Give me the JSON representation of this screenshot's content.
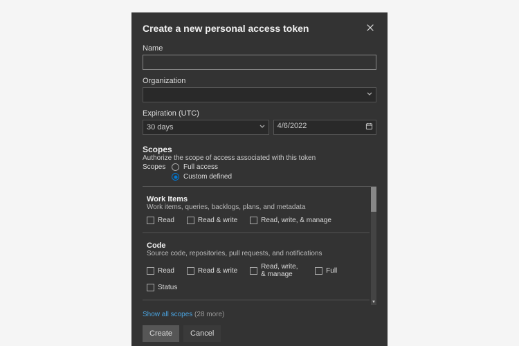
{
  "dialog": {
    "title": "Create a new personal access token"
  },
  "fields": {
    "name_label": "Name",
    "name_value": "",
    "org_label": "Organization",
    "org_value": "",
    "expiration_label": "Expiration (UTC)",
    "expiration_period": "30 days",
    "expiration_date": "4/6/2022"
  },
  "scopes": {
    "heading": "Scopes",
    "description": "Authorize the scope of access associated with this token",
    "label": "Scopes",
    "options": {
      "full": "Full access",
      "custom": "Custom defined"
    },
    "selected": "custom",
    "categories": [
      {
        "title": "Work Items",
        "description": "Work items, queries, backlogs, plans, and metadata",
        "perms": [
          "Read",
          "Read & write",
          "Read, write, & manage"
        ]
      },
      {
        "title": "Code",
        "description": "Source code, repositories, pull requests, and notifications",
        "perms": [
          "Read",
          "Read & write",
          "Read, write, & manage",
          "Full",
          "Status"
        ]
      }
    ],
    "show_all_link": "Show all scopes",
    "show_all_count": "(28 more)"
  },
  "buttons": {
    "create": "Create",
    "cancel": "Cancel"
  }
}
